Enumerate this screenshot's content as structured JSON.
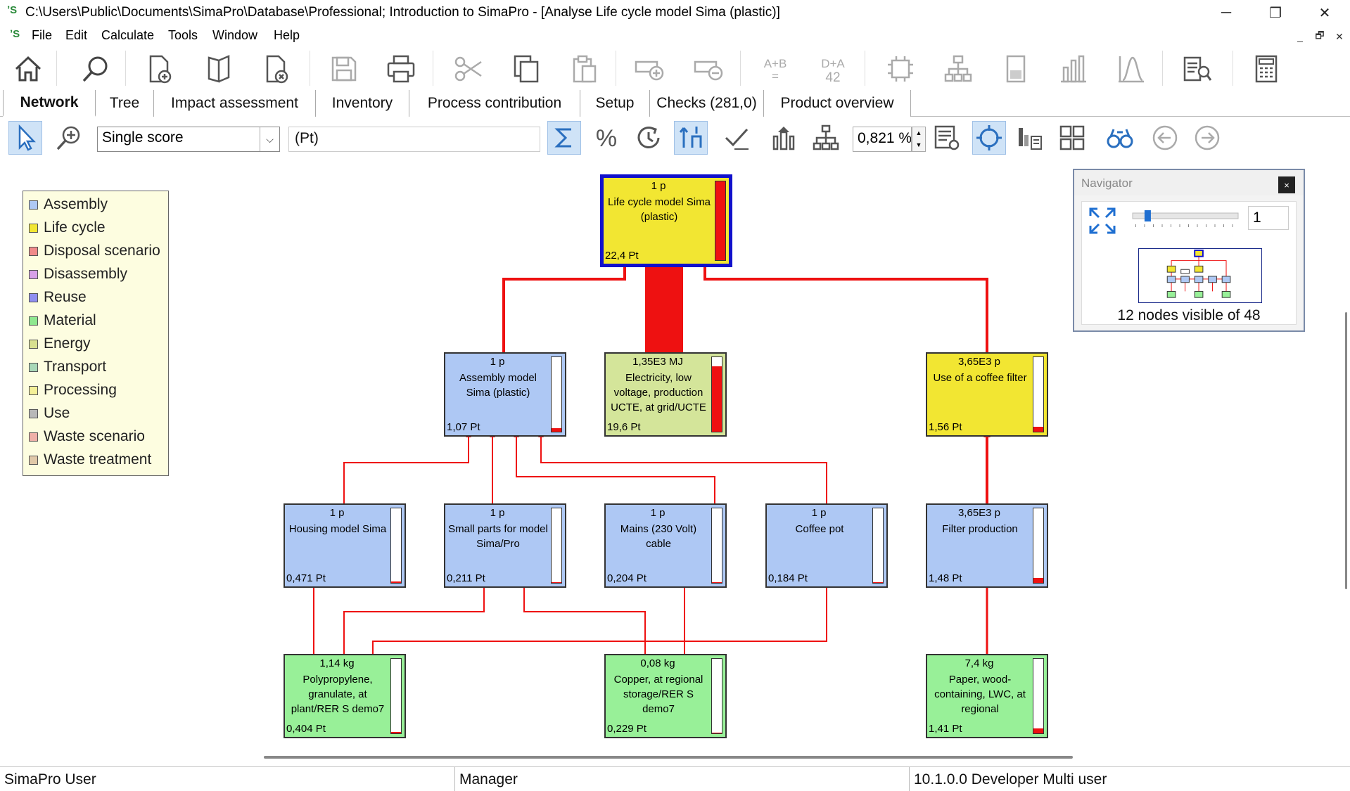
{
  "window": {
    "title": "C:\\Users\\Public\\Documents\\SimaPro\\Database\\Professional; Introduction to SimaPro - [Analyse Life cycle model Sima (plastic)]",
    "minimize_glyph": "─",
    "maximize_glyph": "❐",
    "close_glyph": "✕"
  },
  "menu": {
    "items": [
      "File",
      "Edit",
      "Calculate",
      "Tools",
      "Window",
      "Help"
    ],
    "mdi_glyphs": [
      "_",
      "🗗",
      "✕"
    ]
  },
  "tabs": [
    "Network",
    "Tree",
    "Impact assessment",
    "Inventory",
    "Process contribution",
    "Setup",
    "Checks (281,0)",
    "Product overview"
  ],
  "analysis_toolbar": {
    "score_select": "Single score",
    "unit": "(Pt)",
    "cutoff": "0,821 %"
  },
  "legend": [
    {
      "label": "Assembly",
      "color": "#aec8f4"
    },
    {
      "label": "Life cycle",
      "color": "#f2e632"
    },
    {
      "label": "Disposal scenario",
      "color": "#f08a8a"
    },
    {
      "label": "Disassembly",
      "color": "#d8a0e8"
    },
    {
      "label": "Reuse",
      "color": "#8f8ef0"
    },
    {
      "label": "Material",
      "color": "#8fe88f"
    },
    {
      "label": "Energy",
      "color": "#d8e090"
    },
    {
      "label": "Transport",
      "color": "#a8d8b8"
    },
    {
      "label": "Processing",
      "color": "#f4f098"
    },
    {
      "label": "Use",
      "color": "#b8b8b8"
    },
    {
      "label": "Waste scenario",
      "color": "#f0b0a8"
    },
    {
      "label": "Waste treatment",
      "color": "#e0c8a8"
    }
  ],
  "nodes": [
    {
      "id": "lifecycle",
      "amount": "1 p",
      "name": "Life cycle model Sima (plastic)",
      "score": "22,4 Pt",
      "fill": 1.0,
      "color": "#f2e632"
    },
    {
      "id": "assembly",
      "amount": "1 p",
      "name": "Assembly model Sima (plastic)",
      "score": "1,07 Pt",
      "fill": 0.048,
      "color": "#aec8f4"
    },
    {
      "id": "electricity",
      "amount": "1,35E3 MJ",
      "name": "Electricity, low voltage, production UCTE, at grid/UCTE",
      "score": "19,6 Pt",
      "fill": 0.875,
      "color": "#d4e59a"
    },
    {
      "id": "coffeefilter",
      "amount": "3,65E3 p",
      "name": "Use of a coffee filter",
      "score": "1,56 Pt",
      "fill": 0.07,
      "color": "#f2e632"
    },
    {
      "id": "housing",
      "amount": "1 p",
      "name": "Housing model Sima",
      "score": "0,471 Pt",
      "fill": 0.021,
      "color": "#aec8f4"
    },
    {
      "id": "smallparts",
      "amount": "1 p",
      "name": "Small parts for model Sima/Pro",
      "score": "0,211 Pt",
      "fill": 0.009,
      "color": "#aec8f4"
    },
    {
      "id": "mains",
      "amount": "1 p",
      "name": "Mains (230 Volt) cable",
      "score": "0,204 Pt",
      "fill": 0.009,
      "color": "#aec8f4"
    },
    {
      "id": "coffeepot",
      "amount": "1 p",
      "name": "Coffee pot",
      "score": "0,184 Pt",
      "fill": 0.008,
      "color": "#aec8f4"
    },
    {
      "id": "filterprod",
      "amount": "3,65E3 p",
      "name": "Filter production",
      "score": "1,48 Pt",
      "fill": 0.066,
      "color": "#aec8f4"
    },
    {
      "id": "polypropylene",
      "amount": "1,14 kg",
      "name": "Polypropylene, granulate, at plant/RER S demo7",
      "score": "0,404 Pt",
      "fill": 0.018,
      "color": "#98f098"
    },
    {
      "id": "copper",
      "amount": "0,08 kg",
      "name": "Copper, at regional storage/RER S demo7",
      "score": "0,229 Pt",
      "fill": 0.01,
      "color": "#98f098"
    },
    {
      "id": "paper",
      "amount": "7,4 kg",
      "name": "Paper, wood-containing, LWC, at regional",
      "score": "1,41 Pt",
      "fill": 0.063,
      "color": "#98f098"
    }
  ],
  "navigator": {
    "title": "Navigator",
    "close_glyph": "×",
    "zoom": "1",
    "visible_text": "12 nodes visible of 48",
    "slider_value": 0.12
  },
  "status": {
    "user": "SimaPro User",
    "role": "Manager",
    "version": "10.1.0.0 Developer Multi user"
  }
}
